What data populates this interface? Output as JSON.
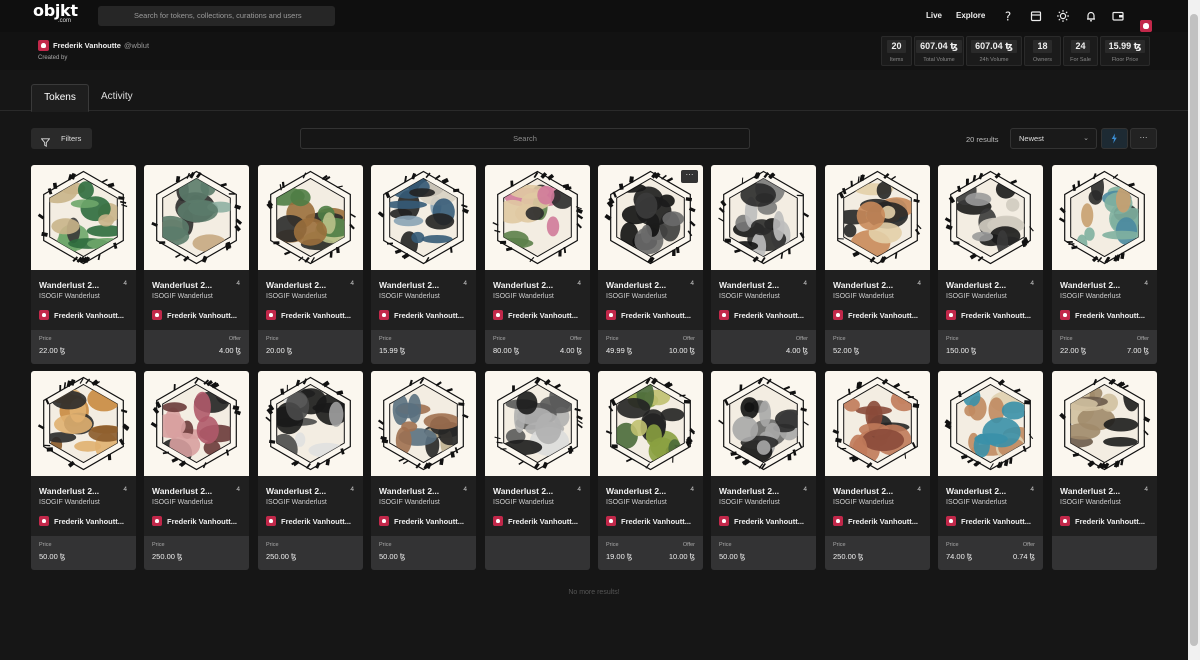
{
  "nav": {
    "logo_main": "objkt",
    "logo_sub": ".com",
    "search_placeholder": "Search for tokens, collections, curations and users",
    "links": [
      "Live",
      "Explore"
    ],
    "icons": [
      "help-icon",
      "shop-icon",
      "theme-sun-icon",
      "notification-bell-icon",
      "wallet-icon",
      "profile-avatar-icon"
    ]
  },
  "collection": {
    "creator_name": "Frederik Vanhoutte",
    "creator_handle": "@wblut",
    "created_by_label": "Created by",
    "stats": [
      {
        "value": "20",
        "label": "Items"
      },
      {
        "value": "607.04 ꜩ",
        "label": "Total Volume"
      },
      {
        "value": "607.04 ꜩ",
        "label": "24h Volume"
      },
      {
        "value": "18",
        "label": "Owners"
      },
      {
        "value": "24",
        "label": "For Sale"
      },
      {
        "value": "15.99 ꜩ",
        "label": "Floor Price"
      }
    ]
  },
  "tabs": [
    "Tokens",
    "Activity"
  ],
  "toolbar": {
    "filters_label": "Filters",
    "search_placeholder": "Search",
    "results_text": "20 results",
    "sort_value": "Newest",
    "more_label": "···"
  },
  "card_common": {
    "title": "Wanderlust 2...",
    "edition": "4",
    "collection": "ISOGIF Wanderlust",
    "artist": "Frederik Vanhoutt...",
    "price_label": "Price",
    "offer_label": "Offer"
  },
  "cards": [
    {
      "price": "22.00 ꜩ",
      "offer": "",
      "palette": [
        "#2e6b3d",
        "#6ea66a",
        "#3a3a3a",
        "#c9b48a"
      ]
    },
    {
      "price": "",
      "offer": "4.00 ꜩ",
      "palette": [
        "#5b7b6a",
        "#c7a882",
        "#2c2c2c",
        "#8fb0a3"
      ]
    },
    {
      "price": "20.00 ꜩ",
      "offer": "",
      "palette": [
        "#4f7d45",
        "#9b6f3c",
        "#2a2a2a",
        "#b9c18a"
      ]
    },
    {
      "price": "15.99 ꜩ",
      "offer": "",
      "palette": [
        "#355b78",
        "#8aa3b5",
        "#222222",
        "#d8d2c4"
      ]
    },
    {
      "price": "80.00 ꜩ",
      "offer": "4.00 ꜩ",
      "palette": [
        "#d07a9a",
        "#5c7f4a",
        "#2b2b2b",
        "#e0c9a2"
      ]
    },
    {
      "price": "49.99 ꜩ",
      "offer": "10.00 ꜩ",
      "palette": [
        "#1c1c1c",
        "#3c3c3c",
        "#111111",
        "#6a6a6a"
      ]
    },
    {
      "price": "",
      "offer": "4.00 ꜩ",
      "palette": [
        "#2a2a2a",
        "#7a7a7a",
        "#141414",
        "#bdbdbd"
      ]
    },
    {
      "price": "52.00 ꜩ",
      "offer": "",
      "palette": [
        "#3d8aa3",
        "#c98a5a",
        "#262626",
        "#e3cfa8"
      ]
    },
    {
      "price": "150.00 ꜩ",
      "offer": "",
      "palette": [
        "#3a3a3a",
        "#9a9a9a",
        "#1a1a1a",
        "#d0cbc0"
      ]
    },
    {
      "price": "22.00 ꜩ",
      "offer": "7.00 ꜩ",
      "palette": [
        "#4a8aa0",
        "#c8a070",
        "#2a2a2a",
        "#7fb0a0"
      ]
    },
    {
      "price": "50.00 ꜩ",
      "offer": "",
      "palette": [
        "#c98a40",
        "#8a5a2a",
        "#2a2a2a",
        "#e0b070"
      ]
    },
    {
      "price": "250.00 ꜩ",
      "offer": "",
      "palette": [
        "#b05a6a",
        "#6a3a3a",
        "#222222",
        "#d8a0a0"
      ]
    },
    {
      "price": "250.00 ꜩ",
      "offer": "",
      "palette": [
        "#4a4a4a",
        "#a0a0a0",
        "#1a1a1a",
        "#e0e0e0"
      ]
    },
    {
      "price": "50.00 ꜩ",
      "offer": "",
      "palette": [
        "#5a7080",
        "#a07050",
        "#262626",
        "#c0b090"
      ]
    },
    {
      "price": "",
      "offer": "",
      "palette": [
        "#5a5a5a",
        "#b0b0b0",
        "#1c1c1c",
        "#dcdcdc"
      ]
    },
    {
      "price": "19.00 ꜩ",
      "offer": "10.00 ꜩ",
      "palette": [
        "#8aa040",
        "#4a6a3a",
        "#222222",
        "#c0c070"
      ]
    },
    {
      "price": "50.00 ꜩ",
      "offer": "",
      "palette": [
        "#2c2c2c",
        "#6a6a6a",
        "#121212",
        "#a8a8a8"
      ]
    },
    {
      "price": "250.00 ꜩ",
      "offer": "",
      "palette": [
        "#c07a5a",
        "#8a4a3a",
        "#262626",
        "#e8c0a0"
      ]
    },
    {
      "price": "74.00 ꜩ",
      "offer": "0.74 ꜩ",
      "palette": [
        "#3a90a8",
        "#c08a60",
        "#222222",
        "#e0d0b0"
      ]
    },
    {
      "price": "",
      "offer": "",
      "palette": [
        "#6a5a4a",
        "#a08a6a",
        "#1c1c1c",
        "#d0c0a0"
      ]
    }
  ],
  "footer_text": "No more results!"
}
